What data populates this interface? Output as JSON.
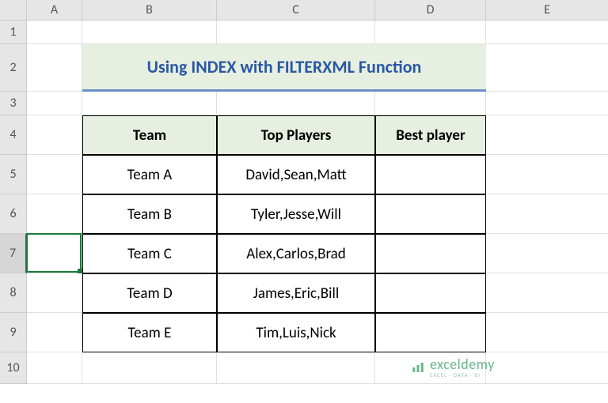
{
  "columns": [
    "A",
    "B",
    "C",
    "D",
    "E"
  ],
  "rows": [
    "1",
    "2",
    "3",
    "4",
    "5",
    "6",
    "7",
    "8",
    "9",
    "10"
  ],
  "title": "Using INDEX with FILTERXML Function",
  "headers": {
    "team": "Team",
    "top_players": "Top Players",
    "best_player": "Best player"
  },
  "data": [
    {
      "team": "Team A",
      "players": "David,Sean,Matt",
      "best": ""
    },
    {
      "team": "Team B",
      "players": "Tyler,Jesse,Will",
      "best": ""
    },
    {
      "team": "Team C",
      "players": "Alex,Carlos,Brad",
      "best": ""
    },
    {
      "team": "Team D",
      "players": "James,Eric,Bill",
      "best": ""
    },
    {
      "team": "Team E",
      "players": "Tim,Luis,Nick",
      "best": ""
    }
  ],
  "watermark": {
    "brand": "exceldemy",
    "tag": "EXCEL · DATA · BI"
  },
  "chart_data": {
    "type": "table",
    "title": "Using INDEX with FILTERXML Function",
    "columns": [
      "Team",
      "Top Players",
      "Best player"
    ],
    "rows": [
      [
        "Team A",
        "David,Sean,Matt",
        ""
      ],
      [
        "Team B",
        "Tyler,Jesse,Will",
        ""
      ],
      [
        "Team C",
        "Alex,Carlos,Brad",
        ""
      ],
      [
        "Team D",
        "James,Eric,Bill",
        ""
      ],
      [
        "Team E",
        "Tim,Luis,Nick",
        ""
      ]
    ]
  }
}
